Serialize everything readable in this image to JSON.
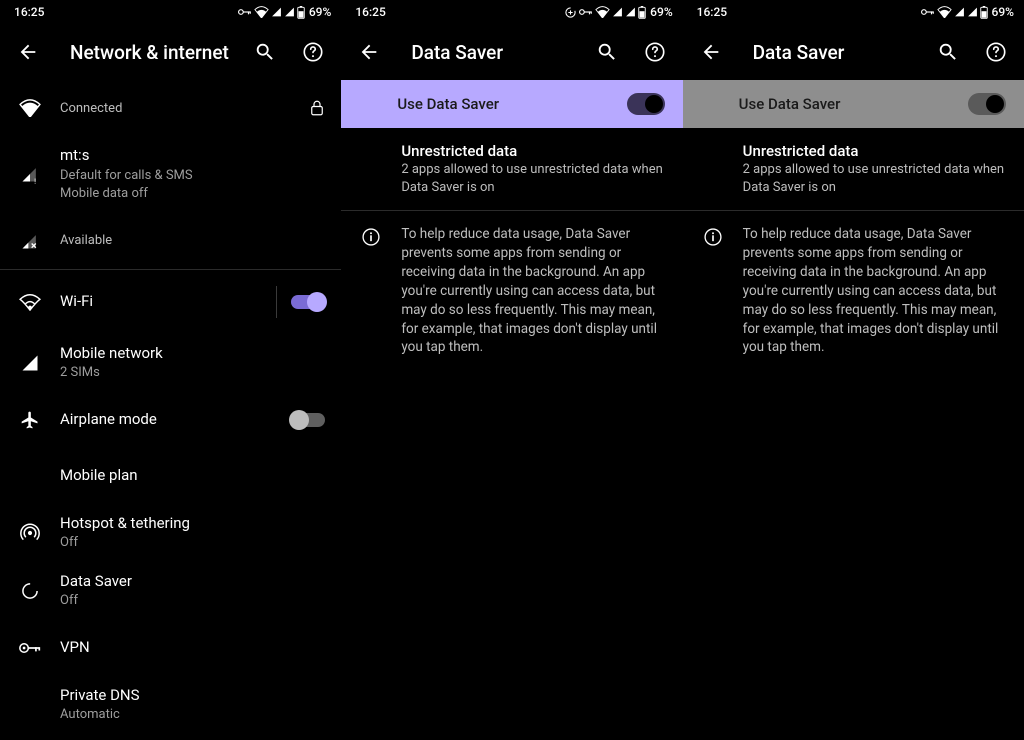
{
  "status": {
    "time": "16:25",
    "battery": "69%"
  },
  "panel1": {
    "title": "Network & internet",
    "connected": "Connected",
    "sim1_name": "mt:s",
    "sim1_sub1": "Default for calls & SMS",
    "sim1_sub2": "Mobile data off",
    "sim2_sub": "Available",
    "wifi": "Wi-Fi",
    "mobile_network": "Mobile network",
    "mobile_network_sub": "2 SIMs",
    "airplane": "Airplane mode",
    "mobile_plan": "Mobile plan",
    "hotspot": "Hotspot & tethering",
    "hotspot_sub": "Off",
    "datasaver": "Data Saver",
    "datasaver_sub": "Off",
    "vpn": "VPN",
    "privatedns": "Private DNS",
    "privatedns_sub": "Automatic"
  },
  "panel2": {
    "title": "Data Saver",
    "use_label": "Use Data Saver",
    "unrestricted_title": "Unrestricted data",
    "unrestricted_sub": "2 apps allowed to use unrestricted data when Data Saver is on",
    "help": "To help reduce data usage, Data Saver prevents some apps from sending or receiving data in the background. An app you're currently using can access data, but may do so less frequently. This may mean, for example, that images don't display until you tap them."
  },
  "panel3": {
    "title": "Data Saver",
    "use_label": "Use Data Saver",
    "unrestricted_title": "Unrestricted data",
    "unrestricted_sub": "2 apps allowed to use unrestricted data when Data Saver is on",
    "help": "To help reduce data usage, Data Saver prevents some apps from sending or receiving data in the background. An app you're currently using can access data, but may do so less frequently. This may mean, for example, that images don't display until you tap them."
  }
}
